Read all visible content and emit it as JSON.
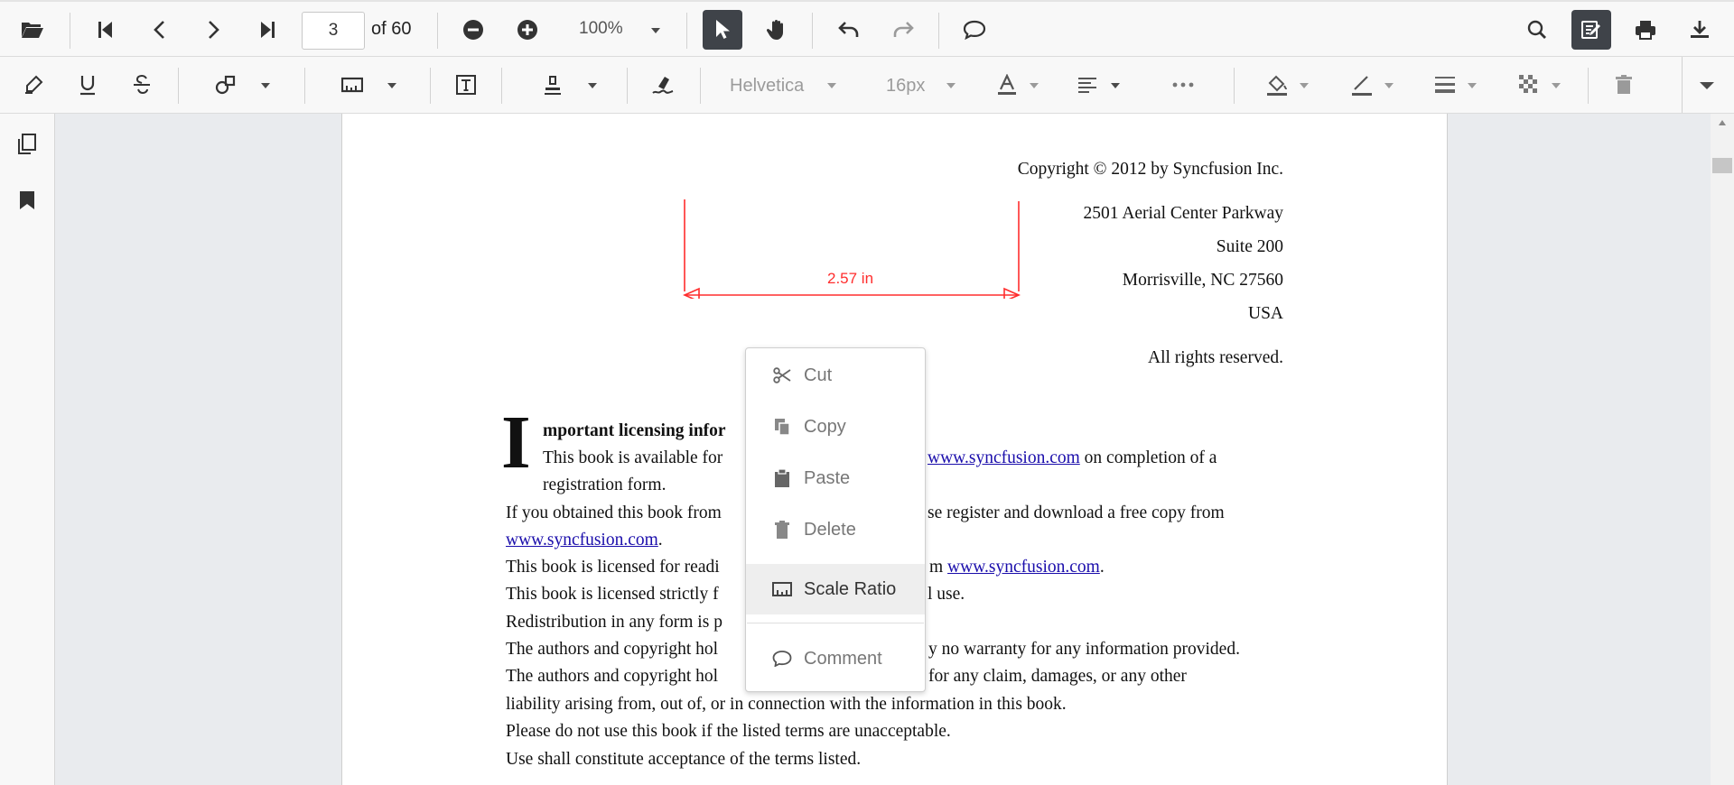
{
  "toolbar": {
    "page_current": "3",
    "page_total_label": "of 60",
    "zoom": "100%"
  },
  "annotation_toolbar": {
    "font_family": "Helvetica",
    "font_size": "16px"
  },
  "document": {
    "copyright": "Copyright © 2012 by Syncfusion Inc.",
    "address_1": "2501 Aerial Center Parkway",
    "address_2": "Suite 200",
    "address_3": "Morrisville, NC 27560",
    "address_4": "USA",
    "rights": "All rights reserved.",
    "measurement_label": "2.57 in",
    "dropcap": "I",
    "heading_visible": "mportant licensing infor",
    "line1_a": "This book is available for",
    "line1_link": "www.syncfusion.com",
    "line1_b": "on completion of a",
    "line2": "registration form.",
    "line3_a": "If you obtained this book from",
    "line3_b": "se register and download a free copy from",
    "line4_link": "www.syncfusion.com",
    "line4_b": ".",
    "line5_a": "This book is licensed for readi",
    "line5_b": "m",
    "line5_link": "www.syncfusion.com",
    "line5_c": ".",
    "line6_a": "This book is licensed strictly f",
    "line6_b": "l use.",
    "line7": "Redistribution in any form is p",
    "line8_a": "The authors and copyright hol",
    "line8_b": "y no warranty for any information provided.",
    "line9_a": "The authors and copyright hol",
    "line9_b": "for any claim, damages, or any other",
    "line10": "liability arising from, out of, or in connection with the information in this book.",
    "line11": "Please do not use this book if the listed terms are unacceptable.",
    "line12": "Use shall constitute acceptance of the terms listed."
  },
  "context_menu": {
    "items": [
      {
        "label": "Cut",
        "icon": "scissors-icon"
      },
      {
        "label": "Copy",
        "icon": "copy-icon"
      },
      {
        "label": "Paste",
        "icon": "paste-icon"
      },
      {
        "label": "Delete",
        "icon": "trash-icon"
      },
      {
        "label": "Scale Ratio",
        "icon": "ruler-icon"
      },
      {
        "label": "Comment",
        "icon": "comment-icon"
      }
    ]
  },
  "colors": {
    "active_button": "#3f4349",
    "measurement": "#ff2d2d",
    "link": "#1a0dab"
  }
}
